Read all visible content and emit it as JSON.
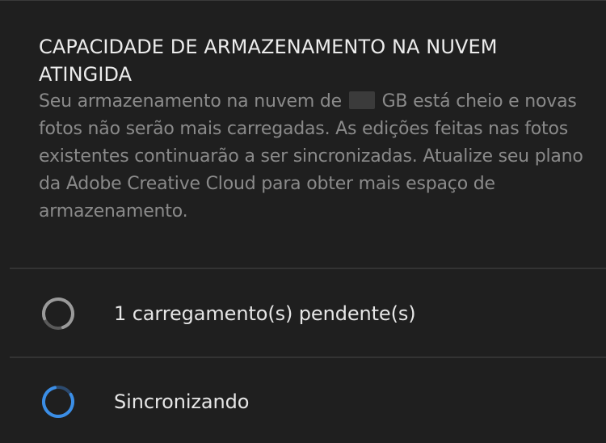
{
  "notice": {
    "title": "CAPACIDADE DE ARMAZENAMENTO NA NUVEM ATINGIDA",
    "body_before": "Seu armazenamento na nuvem de",
    "body_after": "GB está cheio e novas fotos não serão mais carregadas. As edições feitas nas fotos existentes continuarão a ser sincronizadas. Atualize seu plano da Adobe Creative Cloud para obter mais espaço de armazenamento."
  },
  "status": {
    "pending_label": "1 carregamento(s) pendente(s)",
    "syncing_label": "Sincronizando",
    "pending_color": "#9a9a9a",
    "syncing_color": "#3b8ee6"
  }
}
